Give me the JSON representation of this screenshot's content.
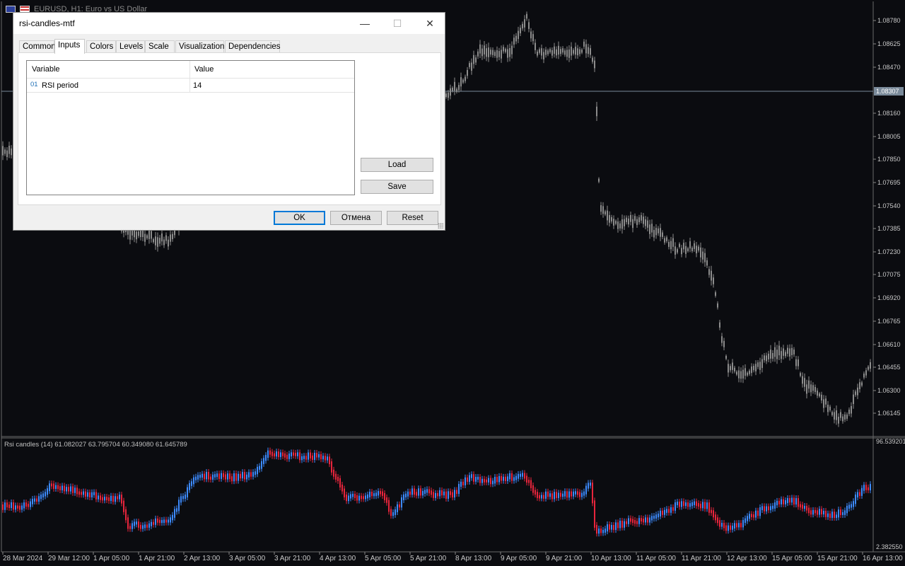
{
  "window": {
    "symbol_title": "EURUSD, H1: Euro vs US Dollar"
  },
  "price_axis": {
    "labels": [
      "1.08780",
      "1.08625",
      "1.08470",
      "1.08160",
      "1.08005",
      "1.07850",
      "1.07695",
      "1.07540",
      "1.07385",
      "1.07230",
      "1.07075",
      "1.06920",
      "1.06765",
      "1.06610",
      "1.06455",
      "1.06300",
      "1.06145"
    ],
    "current_price": "1.08307"
  },
  "indicator": {
    "title": "Rsi candles (14) 61.082027 63.795704 60.349080 61.645789",
    "max_label": "96.539201",
    "min_label": "2.382550"
  },
  "time_axis": {
    "labels": [
      "28 Mar 2024",
      "29 Mar 12:00",
      "1 Apr 05:00",
      "1 Apr 21:00",
      "2 Apr 13:00",
      "3 Apr 05:00",
      "3 Apr 21:00",
      "4 Apr 13:00",
      "5 Apr 05:00",
      "5 Apr 21:00",
      "8 Apr 13:00",
      "9 Apr 05:00",
      "9 Apr 21:00",
      "10 Apr 13:00",
      "11 Apr 05:00",
      "11 Apr 21:00",
      "12 Apr 13:00",
      "15 Apr 05:00",
      "15 Apr 21:00",
      "16 Apr 13:00"
    ]
  },
  "colors": {
    "background": "#0b0c10",
    "price_candle": "#8c8c8c",
    "rsi_up": "#3d8bff",
    "rsi_down": "#e8253c"
  },
  "dialog": {
    "title": "rsi-candles-mtf",
    "minimize": "—",
    "maximize": "☐",
    "close": "✕",
    "tabs": [
      "Common",
      "Inputs",
      "Colors",
      "Levels",
      "Scale",
      "Visualization",
      "Dependencies"
    ],
    "active_tab": "Inputs",
    "grid": {
      "col_variable": "Variable",
      "col_value": "Value",
      "rows": [
        {
          "icon": "01",
          "variable": "RSI period",
          "value": "14"
        }
      ]
    },
    "load_label": "Load",
    "save_label": "Save",
    "ok_label": "OK",
    "cancel_label": "Отмена",
    "reset_label": "Reset"
  }
}
